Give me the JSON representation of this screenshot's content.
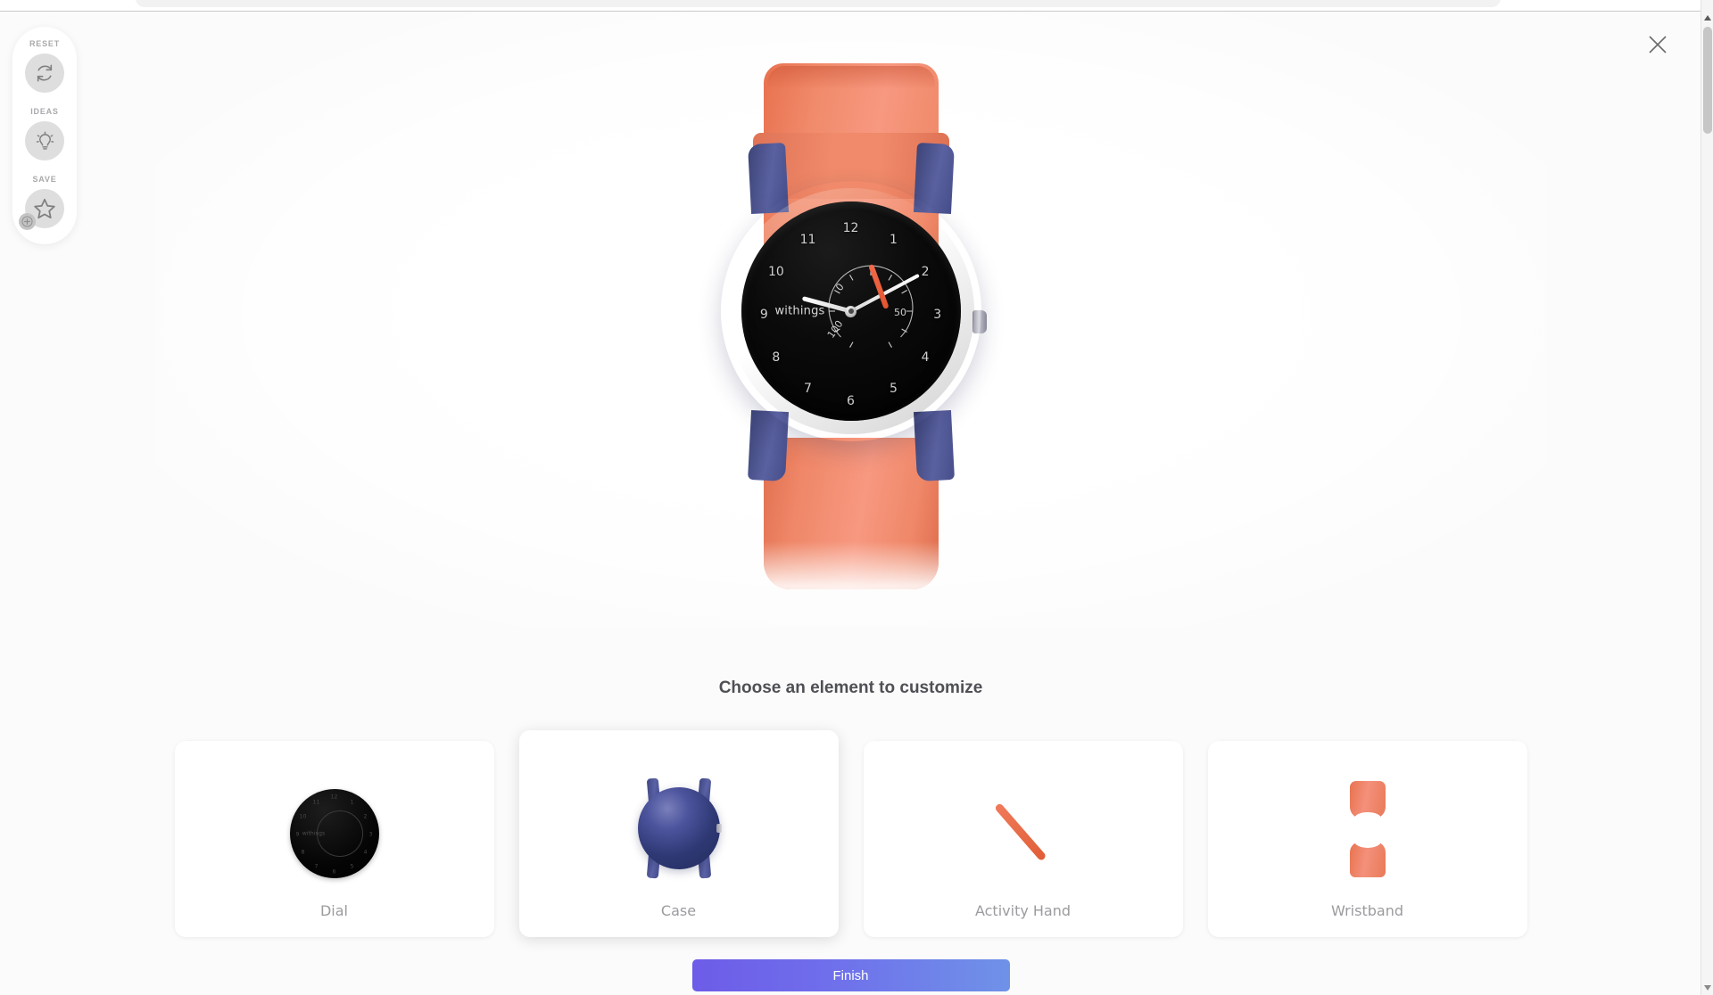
{
  "modal": {
    "close_icon": "close-icon",
    "prompt": "Choose an element to customize",
    "finish_label": "Finish"
  },
  "tool_rail": {
    "tools": [
      {
        "label": "RESET",
        "icon": "refresh-icon"
      },
      {
        "label": "IDEAS",
        "icon": "lightbulb-icon"
      },
      {
        "label": "SAVE",
        "icon": "star-icon",
        "badge": "plus-badge-icon"
      }
    ]
  },
  "watch": {
    "brand": "withings",
    "hour_numerals": [
      "12",
      "1",
      "2",
      "3",
      "4",
      "5",
      "6",
      "7",
      "8",
      "9",
      "10",
      "11"
    ],
    "subdial_labels": [
      "0",
      "50",
      "100"
    ],
    "colors": {
      "case": "#454d92",
      "strap": "#f0876b",
      "dial": "#000000",
      "activity_hand": "#e8603a",
      "hands": "#ffffff",
      "crown": "#b9b9c4"
    }
  },
  "cards": [
    {
      "label": "Dial",
      "thumb": "dial-thumbnail",
      "selected": false
    },
    {
      "label": "Case",
      "thumb": "case-thumbnail",
      "selected": true
    },
    {
      "label": "Activity Hand",
      "thumb": "activity-hand-thumbnail",
      "selected": false
    },
    {
      "label": "Wristband",
      "thumb": "wristband-thumbnail",
      "selected": false
    }
  ],
  "theme": {
    "background": "#fbfbfb",
    "finish_gradient_from": "#6d5ce8",
    "finish_gradient_to": "#6f92e8",
    "label_color": "#9b9ba0",
    "prompt_color": "#4e5055"
  }
}
